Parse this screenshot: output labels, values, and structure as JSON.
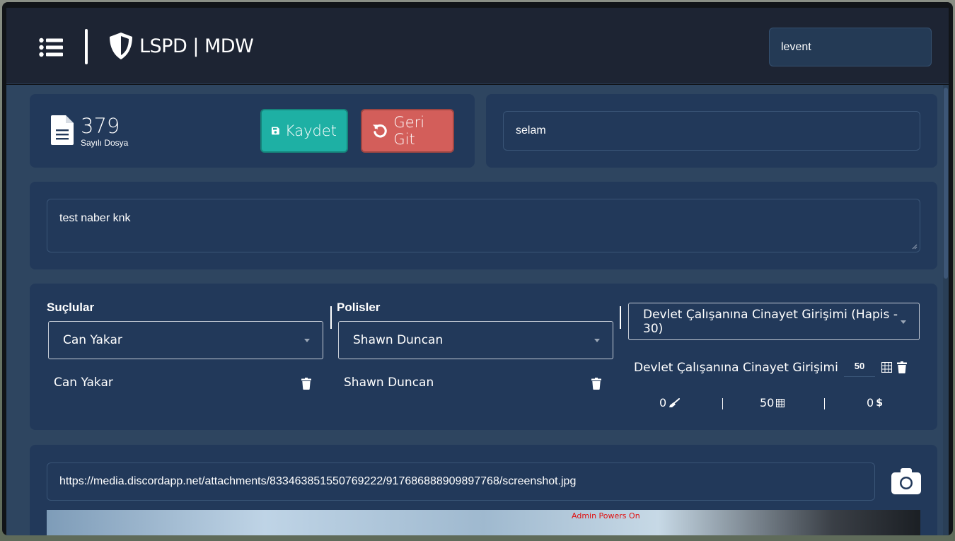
{
  "header": {
    "brand": "LSPD | MDW",
    "user": "levent"
  },
  "file": {
    "number": "379",
    "subtitle": "Sayılı Dosya"
  },
  "buttons": {
    "save": "Kaydet",
    "back": "Geri Git"
  },
  "title_input": {
    "value": "selam"
  },
  "description": {
    "value": "test naber knk"
  },
  "criminals": {
    "title": "Suçlular",
    "selected": "Can Yakar",
    "items": [
      {
        "name": "Can Yakar"
      }
    ]
  },
  "officers": {
    "title": "Polisler",
    "selected": "Shawn Duncan",
    "items": [
      {
        "name": "Shawn Duncan"
      }
    ]
  },
  "charges": {
    "selected": "Devlet Çalışanına Cinayet Girişimi (Hapis - 30)",
    "items": [
      {
        "name": "Devlet Çalışanına Cinayet Girişimi",
        "amount": "50"
      }
    ],
    "totals": {
      "community": "0",
      "jail": "50",
      "fine": "0"
    }
  },
  "evidence": {
    "url": "https://media.discordapp.net/attachments/833463851550769222/917686888909897768/screenshot.jpg",
    "overlay": "Admin Powers On"
  },
  "colors": {
    "save": "#1eb0a4",
    "back": "#d35e5a",
    "panel": "#22395a",
    "background": "#2e4560",
    "header": "#1d2433"
  }
}
